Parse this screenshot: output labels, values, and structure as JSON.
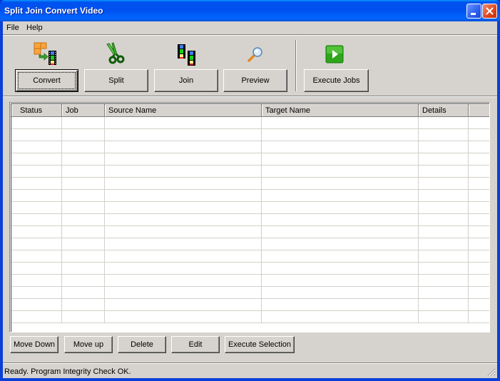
{
  "window": {
    "title": "Split Join Convert Video",
    "controls": [
      "minimize",
      "close"
    ]
  },
  "menu": {
    "items": [
      {
        "label": "File"
      },
      {
        "label": "Help"
      }
    ]
  },
  "toolbar": {
    "buttons": [
      {
        "label": "Convert",
        "icon": "convert-icon",
        "default": true
      },
      {
        "label": "Split",
        "icon": "scissors-icon"
      },
      {
        "label": "Join",
        "icon": "join-films-icon"
      },
      {
        "label": "Preview",
        "icon": "magnifier-icon"
      },
      {
        "label": "Execute Jobs",
        "icon": "play-icon"
      }
    ]
  },
  "jobs_table": {
    "columns": [
      {
        "label": "Status"
      },
      {
        "label": "Job"
      },
      {
        "label": "Source Name"
      },
      {
        "label": "Target Name"
      },
      {
        "label": "Details"
      },
      {
        "label": ""
      }
    ],
    "rows": []
  },
  "actions": {
    "buttons": [
      {
        "label": "Move Down"
      },
      {
        "label": "Move up"
      },
      {
        "label": "Delete"
      },
      {
        "label": "Edit"
      },
      {
        "label": "Execute Selection"
      }
    ]
  },
  "statusbar": {
    "text": "Ready. Program Integrity Check OK."
  },
  "colors": {
    "titlebar": "#0054e3",
    "face": "#d6d3ce",
    "close": "#e0461c",
    "play_green": "#2fa51a"
  }
}
